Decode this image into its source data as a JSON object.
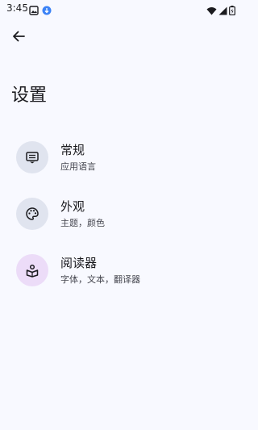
{
  "status_bar": {
    "time": "3:45"
  },
  "header": {
    "title": "设置"
  },
  "settings": {
    "items": [
      {
        "label": "常规",
        "description": "应用语言",
        "icon": "keyboard-icon",
        "icon_bg": "#e0e4ef"
      },
      {
        "label": "外观",
        "description": "主题，颜色",
        "icon": "palette-icon",
        "icon_bg": "#e0e4ef"
      },
      {
        "label": "阅读器",
        "description": "字体，文本，翻译器",
        "icon": "book-reader-icon",
        "icon_bg": "#ecdcf8"
      }
    ]
  },
  "colors": {
    "background": "#f8f9ff",
    "text": "#1b1b1f",
    "secondary_text": "#45464f"
  }
}
